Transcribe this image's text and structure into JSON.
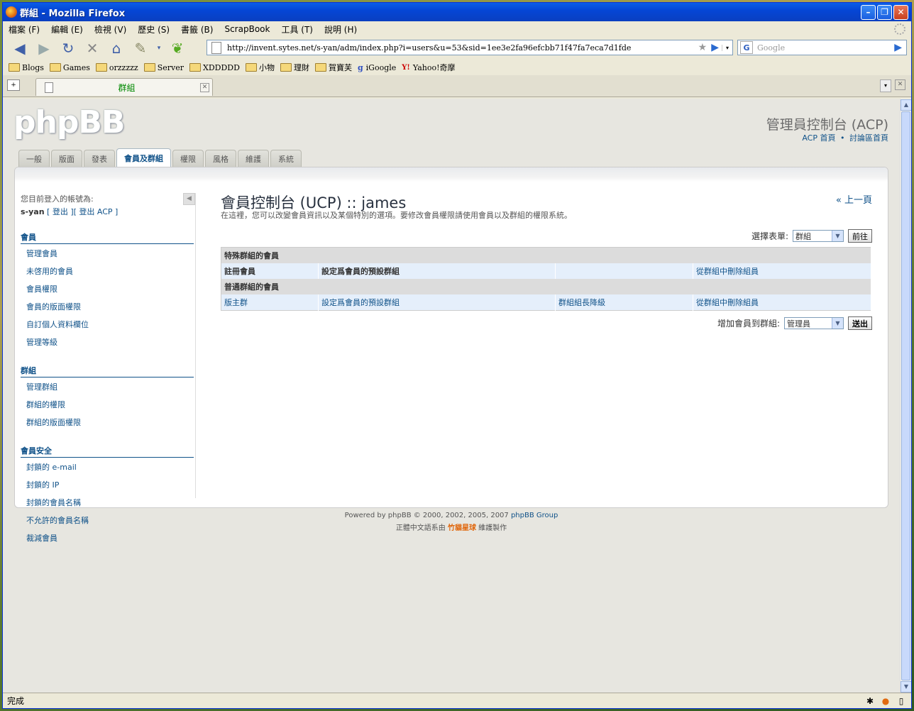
{
  "window": {
    "title": "群組 - Mozilla Firefox"
  },
  "menubar": {
    "items": [
      "檔案 (F)",
      "編輯 (E)",
      "檢視 (V)",
      "歷史 (S)",
      "書籤 (B)",
      "ScrapBook",
      "工具 (T)",
      "說明 (H)"
    ]
  },
  "navbar": {
    "url": "http://invent.sytes.net/s-yan/adm/index.php?i=users&u=53&sid=1ee3e2fa96efcbb71f47fa7eca7d1fde",
    "search_placeholder": "Google",
    "search_engine_letter": "G"
  },
  "bookmarks": [
    "Blogs",
    "Games",
    "orzzzzz",
    "Server",
    "XDDDDD",
    "小物",
    "理財",
    "賀寶芙",
    "iGoogle",
    "Yahoo!奇摩"
  ],
  "browser_tab": {
    "label": "群組"
  },
  "header": {
    "logo": "phpBB",
    "acp_title": "管理員控制台 (ACP)",
    "acp_home": "ACP 首頁",
    "sep": "•",
    "forum_home": "討論區首頁"
  },
  "tabs": [
    "一般",
    "版面",
    "發表",
    "會員及群組",
    "權限",
    "風格",
    "維護",
    "系統"
  ],
  "sidebar": {
    "login_label": "您目前登入的帳號為:",
    "username": "s-yan",
    "logout": "[ 登出 ]",
    "logout_acp": "[ 登出 ACP ]",
    "sections": [
      {
        "title": "會員",
        "items": [
          "管理會員",
          "未啓用的會員",
          "會員權限",
          "會員的版面權限",
          "自訂個人資料欄位",
          "管理等級"
        ]
      },
      {
        "title": "群組",
        "items": [
          "管理群組",
          "群組的權限",
          "群組的版面權限"
        ]
      },
      {
        "title": "會員安全",
        "items": [
          "封鎖的 e-mail",
          "封鎖的 IP",
          "封鎖的會員名稱",
          "不允許的會員名稱",
          "裁減會員"
        ]
      }
    ]
  },
  "main": {
    "title": "會員控制台 (UCP) :: james",
    "description": "在這裡，您可以改變會員資訊以及某個特別的選項。要修改會員權限請使用會員以及群組的權限系統。",
    "back": "« 上一頁",
    "select_label": "選擇表單:",
    "select_value": "群組",
    "go_button": "前往",
    "special_header": "特殊群組的會員",
    "special_row": [
      "註冊會員",
      "設定爲會員的預設群組",
      "",
      "從群組中刪除組員"
    ],
    "normal_header": "普通群組的會員",
    "normal_row": [
      "版主群",
      "設定爲會員的預設群組",
      "群組組長降級",
      "從群組中刪除組員"
    ],
    "add_label": "增加會員到群組:",
    "add_value": "管理員",
    "submit_button": "送出"
  },
  "footer": {
    "line1_prefix": "Powered by phpBB © 2000, 2002, 2005, 2007 ",
    "line1_brand": "phpBB Group",
    "line2_prefix": "正體中文語系由 ",
    "line2_team": "竹貓星球",
    "line2_suffix": " 維護製作"
  },
  "statusbar": {
    "text": "完成"
  }
}
